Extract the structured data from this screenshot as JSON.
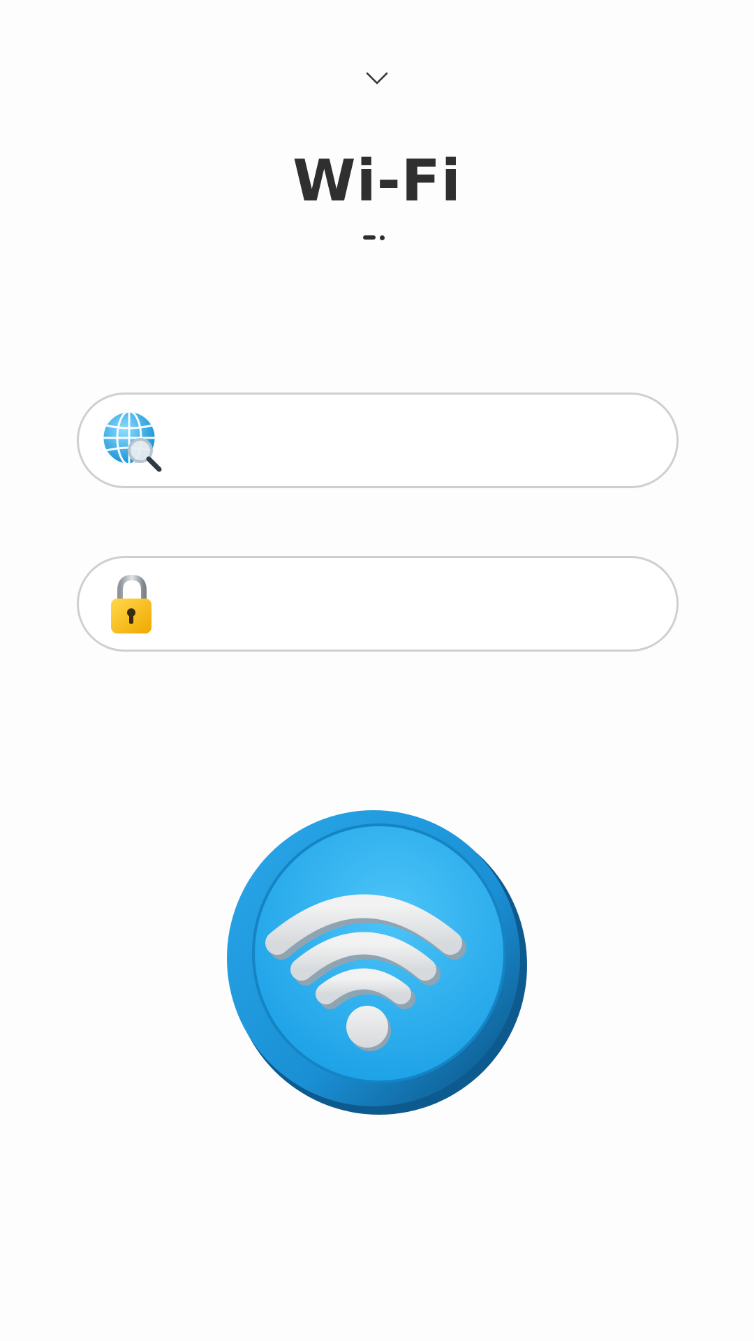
{
  "header": {
    "collapse_icon": "chevron-down-icon",
    "title": "Wi-Fi"
  },
  "form": {
    "ssid": {
      "icon": "globe-search-icon",
      "value": "",
      "placeholder": ""
    },
    "password": {
      "icon": "padlock-icon",
      "value": "",
      "placeholder": ""
    }
  },
  "connect_button": {
    "icon": "wifi-icon"
  },
  "colors": {
    "background": "#fdfdfd",
    "title": "#2f2f2f",
    "field_border": "#cfcfcf",
    "accent_blue": "#1fa3e6",
    "lock_yellow": "#f6c21b"
  }
}
